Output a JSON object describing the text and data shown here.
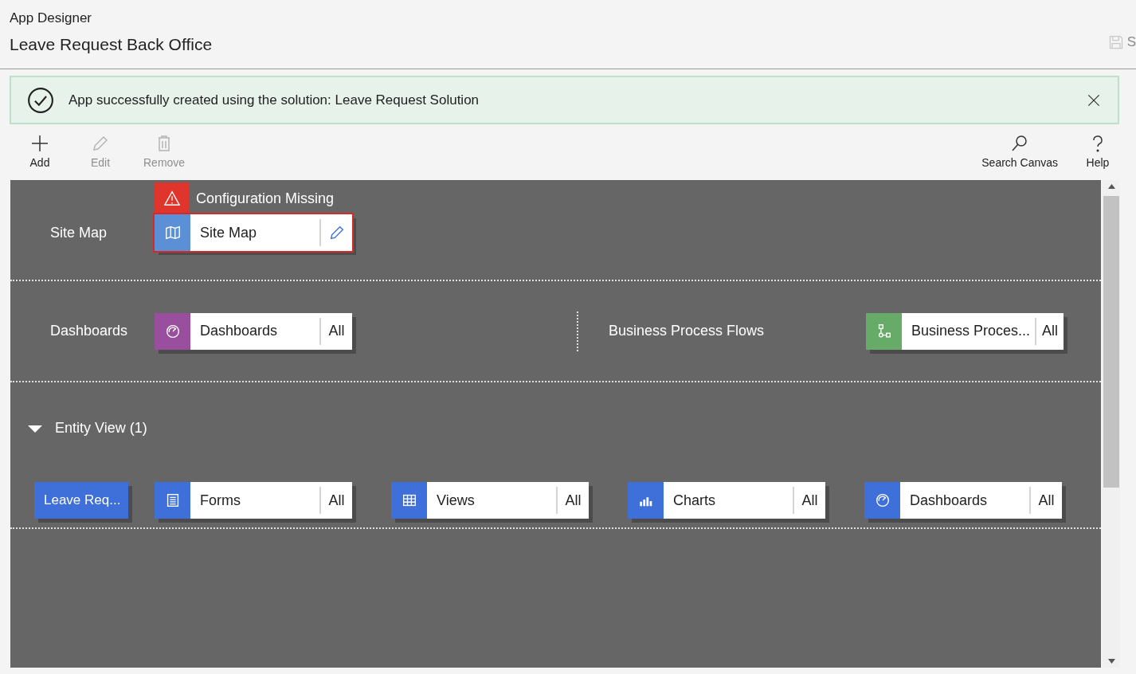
{
  "header": {
    "app_label": "App Designer",
    "title": "Leave Request Back Office",
    "save_label": "S"
  },
  "notification": {
    "kind": "success",
    "message": "App successfully created using the solution: Leave Request Solution"
  },
  "toolbar": {
    "left": [
      {
        "kind": "add",
        "label": "Add",
        "disabled": false
      },
      {
        "kind": "edit",
        "label": "Edit",
        "disabled": true
      },
      {
        "kind": "remove",
        "label": "Remove",
        "disabled": true
      }
    ],
    "right": [
      {
        "kind": "search",
        "label": "Search Canvas",
        "disabled": false
      },
      {
        "kind": "help",
        "label": "Help",
        "disabled": false
      }
    ]
  },
  "canvas": {
    "site_map": {
      "label": "Site Map",
      "warning": "Configuration Missing",
      "tile": {
        "kind": "sitemap",
        "label": "Site Map",
        "color": "#5b8fd6",
        "error": true
      }
    },
    "components": [
      {
        "label": "Dashboards",
        "tile": {
          "kind": "dashboard",
          "label": "Dashboards",
          "color": "#9a4f9e",
          "error": false,
          "action_label": "All"
        }
      },
      {
        "label": "Business Process Flows",
        "tile": {
          "kind": "process",
          "label": "Business Proces...",
          "color": "#67ab68",
          "error": false,
          "action_label": "All"
        }
      }
    ],
    "entity_view": {
      "label": "Entity View (1)",
      "expanded": true,
      "entity": "Leave Req...",
      "tiles": [
        {
          "kind": "form",
          "label": "Forms",
          "color": "#3f6fd8",
          "error": false,
          "action_label": "All"
        },
        {
          "kind": "view",
          "label": "Views",
          "color": "#3f6fd8",
          "error": false,
          "action_label": "All"
        },
        {
          "kind": "chart",
          "label": "Charts",
          "color": "#3f6fd8",
          "error": false,
          "action_label": "All"
        },
        {
          "kind": "dashboard",
          "label": "Dashboards",
          "color": "#3f6fd8",
          "error": false,
          "action_label": "All"
        }
      ]
    }
  }
}
